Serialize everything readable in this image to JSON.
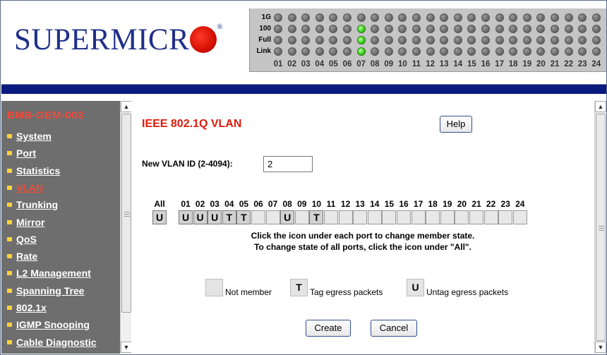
{
  "header": {
    "logo_text": "SUPERMICR",
    "logo_reg": "®",
    "led_rows": [
      "1G",
      "100",
      "Full",
      "Link"
    ],
    "led_on": {
      "100": [
        7
      ],
      "Full": [
        7
      ],
      "Link": [
        7
      ]
    },
    "port_numbers": [
      "01",
      "02",
      "03",
      "04",
      "05",
      "06",
      "07",
      "08",
      "09",
      "10",
      "11",
      "12",
      "13",
      "14",
      "15",
      "16",
      "17",
      "18",
      "19",
      "20",
      "21",
      "22",
      "23",
      "24"
    ]
  },
  "sidebar": {
    "device_name": "BMB-GEM-003",
    "items": [
      {
        "label": "System",
        "active": false
      },
      {
        "label": "Port",
        "active": false
      },
      {
        "label": "Statistics",
        "active": false
      },
      {
        "label": "VLAN",
        "active": true
      },
      {
        "label": "Trunking",
        "active": false
      },
      {
        "label": "Mirror",
        "active": false
      },
      {
        "label": "QoS",
        "active": false
      },
      {
        "label": "Rate",
        "active": false
      },
      {
        "label": "L2 Management",
        "active": false
      },
      {
        "label": "Spanning Tree",
        "active": false
      },
      {
        "label": "802.1x",
        "active": false
      },
      {
        "label": "IGMP Snooping",
        "active": false
      },
      {
        "label": "Cable Diagnostic",
        "active": false
      }
    ]
  },
  "main": {
    "title": "IEEE 802.1Q VLAN",
    "help_label": "Help",
    "vlan_id_label": "New VLAN ID (2-4094):",
    "vlan_id_value": "2",
    "all_label": "All",
    "all_state": "U",
    "ports": [
      "01",
      "02",
      "03",
      "04",
      "05",
      "06",
      "07",
      "08",
      "09",
      "10",
      "11",
      "12",
      "13",
      "14",
      "15",
      "16",
      "17",
      "18",
      "19",
      "20",
      "21",
      "22",
      "23",
      "24"
    ],
    "port_states": [
      "U",
      "U",
      "U",
      "T",
      "T",
      "",
      "",
      "U",
      "",
      "T",
      "",
      "",
      "",
      "",
      "",
      "",
      "",
      "",
      "",
      "",
      "",
      "",
      "",
      ""
    ],
    "note_line1": "Click the icon under each port to change member state.",
    "note_line2": "To change state of all ports, click the icon under \"All\".",
    "legend": {
      "not_member": "Not member",
      "tag_symbol": "T",
      "tag_text": "Tag egress packets",
      "untag_symbol": "U",
      "untag_text": "Untag egress packets"
    },
    "create_label": "Create",
    "cancel_label": "Cancel"
  },
  "colors": {
    "brand_blue": "#1f2f8a",
    "logo_red": "#d20f00",
    "nav_bar": "#0a1a7e",
    "sidebar_bg": "#6e6e6e",
    "title_red": "#e01a0a",
    "led_on": "#39d41d"
  }
}
